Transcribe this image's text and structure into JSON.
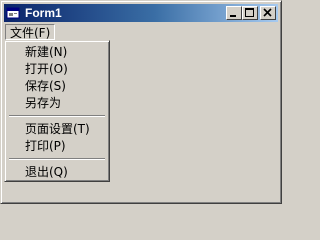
{
  "window": {
    "title": "Form1",
    "icon": "form-icon",
    "controls": [
      "minimize-icon",
      "maximize-icon",
      "close-icon"
    ]
  },
  "menubar": {
    "file_label": "文件(F)"
  },
  "file_menu": {
    "items": [
      {
        "label": "新建(N)"
      },
      {
        "label": "打开(O)"
      },
      {
        "label": "保存(S)"
      },
      {
        "label": "另存为"
      },
      {
        "label": "页面设置(T)"
      },
      {
        "label": "打印(P)"
      },
      {
        "label": "退出(Q)"
      }
    ]
  },
  "colors": {
    "title_start": "#0a246a",
    "title_end": "#a6caf0",
    "face": "#d4d0c8"
  }
}
